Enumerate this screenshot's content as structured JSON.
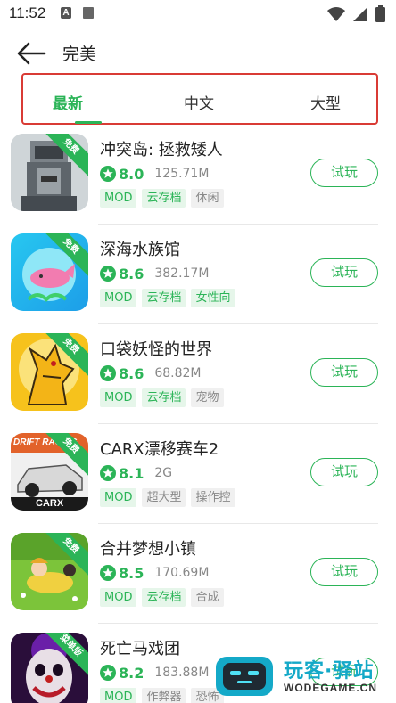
{
  "status_bar": {
    "time": "11:52",
    "a_badge": "A"
  },
  "header": {
    "title": "完美"
  },
  "tabs": [
    {
      "label": "最新",
      "active": true
    },
    {
      "label": "中文",
      "active": false
    },
    {
      "label": "大型",
      "active": false
    }
  ],
  "colors": {
    "accent": "#2bb457",
    "tab_border": "#d93b35"
  },
  "games": [
    {
      "name": "冲突岛: 拯救矮人",
      "rating": "8.0",
      "size": "125.71M",
      "badge": "免费",
      "tags": [
        {
          "text": "MOD",
          "style": "green"
        },
        {
          "text": "云存档",
          "style": "green"
        },
        {
          "text": "休闲",
          "style": "gray"
        }
      ],
      "button": "试玩",
      "icon": "stone-warrior-icon"
    },
    {
      "name": "深海水族馆",
      "rating": "8.6",
      "size": "382.17M",
      "badge": "免费",
      "tags": [
        {
          "text": "MOD",
          "style": "green"
        },
        {
          "text": "云存档",
          "style": "green"
        },
        {
          "text": "女性向",
          "style": "green"
        }
      ],
      "button": "试玩",
      "icon": "pink-whale-icon"
    },
    {
      "name": "口袋妖怪的世界",
      "rating": "8.6",
      "size": "68.82M",
      "badge": "免费",
      "tags": [
        {
          "text": "MOD",
          "style": "green"
        },
        {
          "text": "云存档",
          "style": "green"
        },
        {
          "text": "宠物",
          "style": "gray"
        }
      ],
      "button": "试玩",
      "icon": "yellow-beast-icon"
    },
    {
      "name": "CARX漂移赛车2",
      "rating": "8.1",
      "size": "2G",
      "badge": "免费",
      "tags": [
        {
          "text": "MOD",
          "style": "green"
        },
        {
          "text": "超大型",
          "style": "gray"
        },
        {
          "text": "操作控",
          "style": "gray"
        }
      ],
      "button": "试玩",
      "icon": "drift-car-icon",
      "icon_text_top": "DRIFT RACING",
      "icon_text_bottom": "CARX"
    },
    {
      "name": "合并梦想小镇",
      "rating": "8.5",
      "size": "170.69M",
      "badge": "免费",
      "tags": [
        {
          "text": "MOD",
          "style": "green"
        },
        {
          "text": "云存档",
          "style": "green"
        },
        {
          "text": "合成",
          "style": "gray"
        }
      ],
      "button": "试玩",
      "icon": "meadow-girl-icon"
    },
    {
      "name": "死亡马戏团",
      "rating": "8.2",
      "size": "183.88M",
      "badge": "菜单版",
      "tags": [
        {
          "text": "MOD",
          "style": "green"
        },
        {
          "text": "作弊器",
          "style": "gray"
        },
        {
          "text": "恐怖",
          "style": "gray"
        }
      ],
      "button": "试玩",
      "icon": "clown-icon"
    }
  ],
  "watermark": {
    "text": "玩客·驿站",
    "domain": "WODEGAME.CN"
  }
}
